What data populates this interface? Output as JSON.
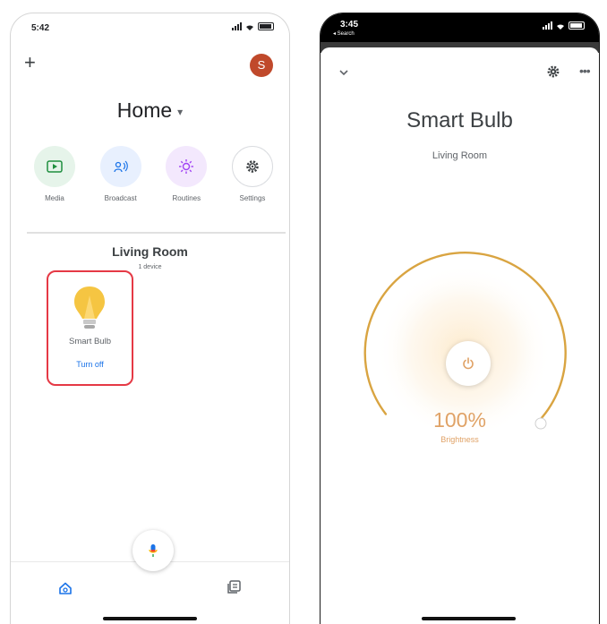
{
  "left_screen": {
    "status_time": "5:42",
    "add_icon": "+",
    "account_initial": "S",
    "home_name": "Home",
    "home_caret": "▾",
    "shortcuts": [
      {
        "label": "Media",
        "icon": "media-icon"
      },
      {
        "label": "Broadcast",
        "icon": "broadcast-icon"
      },
      {
        "label": "Routines",
        "icon": "routines-icon"
      },
      {
        "label": "Settings",
        "icon": "gear-icon"
      }
    ],
    "room": {
      "name": "Living Room",
      "device_count": "1 device"
    },
    "device": {
      "name": "Smart Bulb",
      "action": "Turn off",
      "icon": "bulb-icon"
    },
    "bottom_nav": [
      "home-icon",
      "feed-icon"
    ],
    "mic_icon": "mic-icon"
  },
  "right_screen": {
    "status_time": "3:45",
    "back_label": "◂ Search",
    "device_name": "Smart Bulb",
    "room_name": "Living Room",
    "brightness": {
      "value": 100,
      "display": "100%",
      "label": "Brightness"
    },
    "power_icon": "power-icon"
  },
  "colors": {
    "accent_blue": "#1a73e8",
    "avatar": "#c0492b",
    "highlight_border": "#e53945",
    "bulb_yellow": "#f5c542",
    "brightness_orange": "#e0a266",
    "dial_ring": "#d9a441"
  }
}
